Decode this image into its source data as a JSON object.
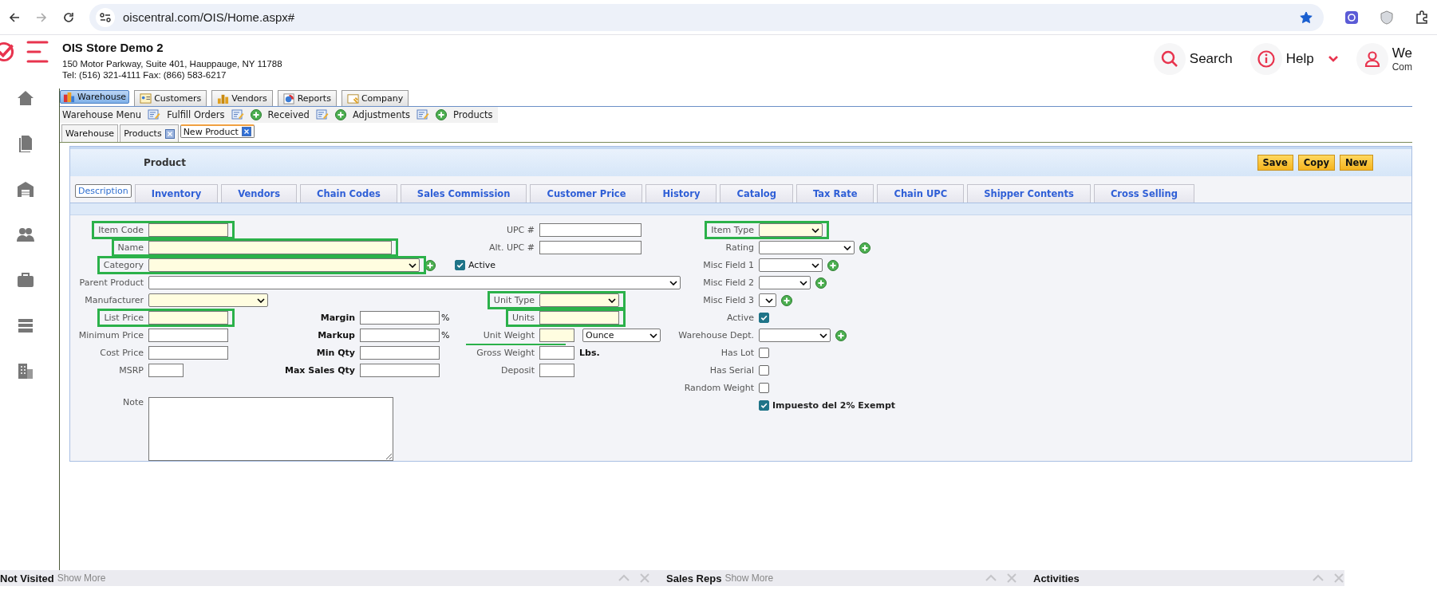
{
  "browser": {
    "url": "oiscentral.com/OIS/Home.aspx#",
    "bookmarked": true
  },
  "app": {
    "store_name": "OIS Store Demo 2",
    "address": "150 Motor Parkway, Suite 401, Hauppauge, NY 11788",
    "contact": "Tel: (516) 321-4111 Fax: (866) 583-6217"
  },
  "header_actions": [
    {
      "kind": "search",
      "label": "Search"
    },
    {
      "kind": "help",
      "label": "Help"
    },
    {
      "kind": "user",
      "label": "We",
      "sublabel": "Com"
    }
  ],
  "module_tabs": [
    {
      "kind": "warehouse",
      "label": "Warehouse",
      "selected": true
    },
    {
      "kind": "customers",
      "label": "Customers",
      "selected": false
    },
    {
      "kind": "vendors",
      "label": "Vendors",
      "selected": false
    },
    {
      "kind": "reports",
      "label": "Reports",
      "selected": false
    },
    {
      "kind": "company",
      "label": "Company",
      "selected": false
    }
  ],
  "sub_menu": [
    {
      "label": "Warehouse Menu",
      "edit": true,
      "add": false
    },
    {
      "label": "Fulfill Orders",
      "edit": true,
      "add": true
    },
    {
      "label": "Received",
      "edit": true,
      "add": true
    },
    {
      "label": "Adjustments",
      "edit": true,
      "add": true
    },
    {
      "label": "Products",
      "edit": false,
      "add": false
    }
  ],
  "page_tabs": [
    {
      "label": "Warehouse",
      "selected": false,
      "closable": false
    },
    {
      "label": "Products",
      "selected": false,
      "closable": true
    },
    {
      "label": "New Product",
      "selected": true,
      "closable": true
    }
  ],
  "panel": {
    "title": "Product",
    "buttons": [
      "Save",
      "Copy",
      "New"
    ]
  },
  "form_tabs": [
    {
      "label": "Description",
      "selected": true
    },
    {
      "label": "Inventory",
      "selected": false
    },
    {
      "label": "Vendors",
      "selected": false
    },
    {
      "label": "Chain Codes",
      "selected": false
    },
    {
      "label": "Sales Commission",
      "selected": false
    },
    {
      "label": "Customer Price",
      "selected": false
    },
    {
      "label": "History",
      "selected": false
    },
    {
      "label": "Catalog",
      "selected": false
    },
    {
      "label": "Tax Rate",
      "selected": false
    },
    {
      "label": "Chain UPC",
      "selected": false
    },
    {
      "label": "Shipper Contents",
      "selected": false
    },
    {
      "label": "Cross Selling",
      "selected": false
    }
  ],
  "form_rows": [
    {
      "left": {
        "label": "Item Code",
        "kind": "text",
        "required": true,
        "boxed": true
      },
      "center": {
        "label": "UPC #",
        "kind": "text",
        "required": false
      },
      "right": {
        "label": "Item Type",
        "kind": "select",
        "required": true,
        "boxed": true
      }
    },
    {
      "left": {
        "label": "Name",
        "kind": "text",
        "required": true,
        "boxed": true
      },
      "center": {
        "label": "Alt. UPC #",
        "kind": "text",
        "required": false
      },
      "right": {
        "label": "Rating",
        "kind": "select",
        "required": false,
        "add": true
      }
    },
    {
      "left": {
        "label": "Category",
        "kind": "select",
        "required": true,
        "add": true,
        "boxed": true
      },
      "center": {
        "label": "Active",
        "kind": "option",
        "checked": true
      },
      "right": {
        "label": "Misc Field 1",
        "kind": "select",
        "required": false,
        "add": true
      }
    },
    {
      "left": {
        "label": "Parent Product",
        "kind": "select",
        "required": false
      },
      "right": {
        "label": "Misc Field 2",
        "kind": "select",
        "required": false,
        "add": true
      }
    },
    {
      "left": {
        "label": "Manufacturer",
        "kind": "select",
        "required": true
      },
      "center": {
        "label": "Unit Type",
        "kind": "select",
        "required": true,
        "boxed": true
      },
      "right": {
        "label": "Misc Field 3",
        "kind": "select",
        "required": false,
        "add": true
      }
    },
    {
      "left": {
        "label": "List Price",
        "kind": "text",
        "required": true,
        "boxed": true
      },
      "margin": {
        "label": "Margin",
        "kind": "text",
        "required": false,
        "suffix": "%"
      },
      "center": {
        "label": "Units",
        "kind": "text",
        "required": true,
        "boxed": true
      },
      "right": {
        "label": "Active",
        "kind": "checkbox",
        "checked": true
      }
    },
    {
      "left": {
        "label": "Minimum Price",
        "kind": "text",
        "required": false
      },
      "margin": {
        "label": "Markup",
        "kind": "text",
        "required": false,
        "suffix": "%"
      },
      "center": {
        "label": "Unit Weight",
        "kind": "text",
        "required": true,
        "unit_select": "Ounce",
        "underlined": true
      },
      "right": {
        "label": "Warehouse Dept.",
        "kind": "select",
        "required": false,
        "add": true
      }
    },
    {
      "left": {
        "label": "Cost Price",
        "kind": "text",
        "required": false
      },
      "margin": {
        "label": "Min Qty",
        "kind": "text",
        "required": false
      },
      "center": {
        "label": "Gross Weight",
        "kind": "text",
        "required": false,
        "suffix": "Lbs."
      },
      "right": {
        "label": "Has Lot",
        "kind": "checkbox",
        "checked": false
      }
    },
    {
      "left": {
        "label": "MSRP",
        "kind": "text",
        "required": false
      },
      "margin": {
        "label": "Max Sales Qty",
        "kind": "text",
        "required": false
      },
      "center": {
        "label": "Deposit",
        "kind": "text",
        "required": false
      },
      "right": {
        "label": "Has Serial",
        "kind": "checkbox",
        "checked": false
      }
    },
    {
      "right": {
        "label": "Random Weight",
        "kind": "checkbox",
        "checked": false
      }
    },
    {
      "left": {
        "label": "Note",
        "kind": "textarea",
        "required": false
      },
      "right": {
        "label": "Impuesto del 2% Exempt",
        "kind": "option",
        "checked": true
      }
    }
  ],
  "dashboard_bar": [
    {
      "title": "Not Visited",
      "link": "Show More"
    },
    {
      "title": "Sales Reps",
      "link": "Show More"
    },
    {
      "title": "Activities"
    }
  ]
}
